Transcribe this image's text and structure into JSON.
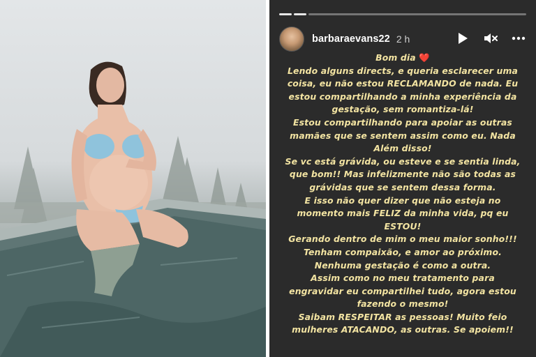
{
  "story": {
    "username": "barbaraevans22",
    "time": "2 h",
    "progress": {
      "segments": 3,
      "completed": 2
    },
    "colors": {
      "background": "#2b2b2b",
      "caption_text": "#f3e4a2",
      "heart": "#e5261f"
    },
    "icons": [
      "play-icon",
      "mute-icon",
      "more-icon"
    ],
    "heart_emoji": "❤️",
    "caption_lines": [
      "Bom dia",
      "Lendo alguns directs, e queria esclarecer uma",
      "coisa, eu não estou RECLAMANDO de nada. Eu",
      "estou compartilhando a minha experiência da",
      "gestação, sem romantiza-lá!",
      "Estou compartilhando para apoiar as outras",
      "mamães que se sentem assim como eu. Nada",
      "Além disso!",
      "Se vc está grávida, ou esteve e se sentia linda,",
      "que bom!! Mas infelizmente não são todas as",
      "grávidas que se sentem dessa forma.",
      "E isso não quer dizer que não esteja no",
      "momento mais FELIZ da minha vida, pq eu",
      "ESTOU!",
      "Gerando dentro de mim o meu maior sonho!!!",
      "Tenham compaixão, e amor ao próximo.",
      "Nenhuma gestação é como a outra.",
      "Assim como no meu tratamento para",
      "engravidar eu compartilhei tudo, agora estou",
      "fazendo o mesmo!",
      "Saibam RESPEITAR as pessoas! Muito feio",
      "mulheres ATACANDO, as outras. Se apoiem!!"
    ]
  }
}
